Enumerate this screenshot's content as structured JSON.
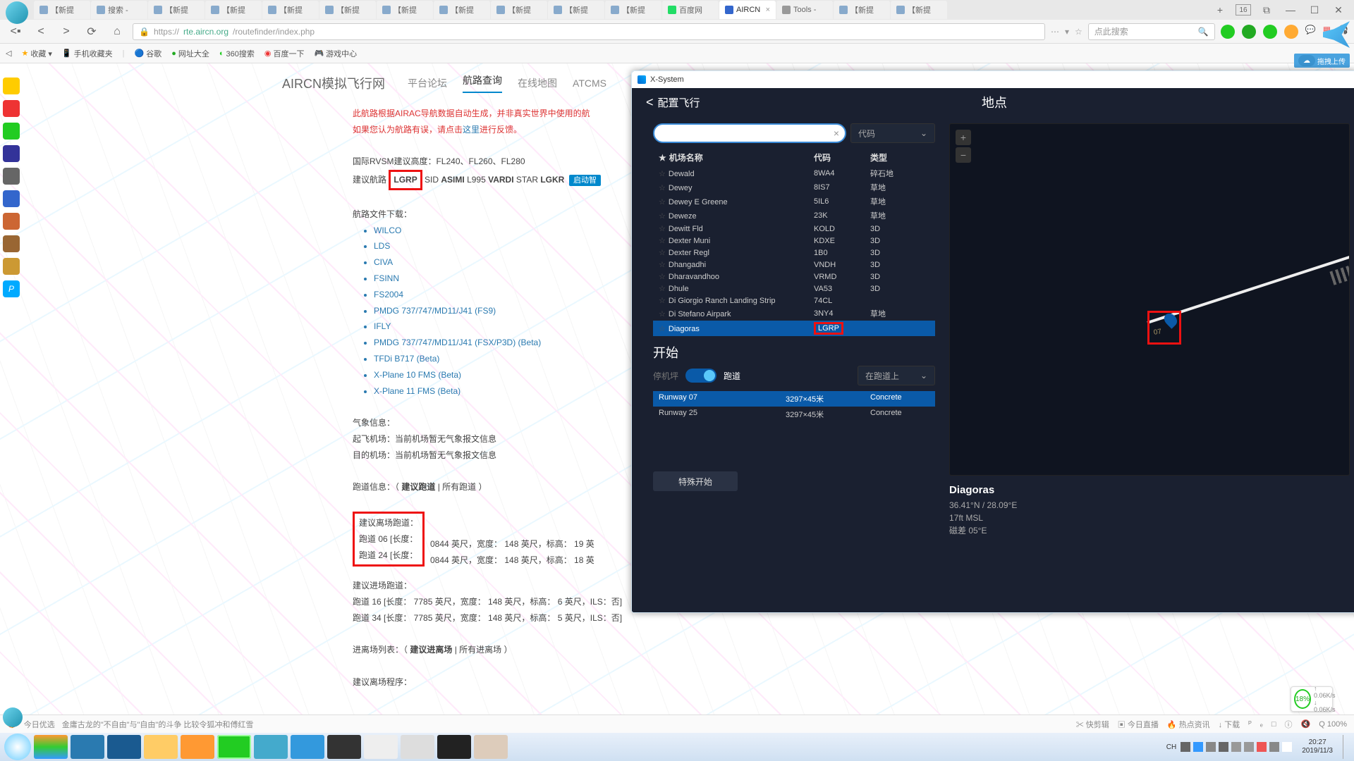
{
  "browser": {
    "tabs": [
      "【新提",
      "搜索 -",
      "【新提",
      "【新提",
      "【新提",
      "【新提",
      "【新提",
      "【新提",
      "【新提",
      "【新提",
      "【新提",
      "百度网",
      "AIRCN",
      "Tools -",
      "【新提",
      "【新提"
    ],
    "active_tab_index": 12,
    "tab_count_badge": "16",
    "url_host": "https://",
    "url_mid": "rte.aircn.org",
    "url_path": "/routefinder/index.php",
    "search_placeholder": "点此搜索",
    "upload_btn": "拖拽上传"
  },
  "bookmarks": [
    "收藏 ▾",
    "手机收藏夹",
    "谷歌",
    "网址大全",
    "360搜索",
    "百度一下",
    "游戏中心"
  ],
  "site": {
    "title": "AIRCN模拟飞行网",
    "nav": [
      "平台论坛",
      "航路查询",
      "在线地图",
      "ATCMS"
    ],
    "active_nav": 1
  },
  "route": {
    "warn1": "此航路根据AIRAC导航数据自动生成，并非真实世界中使用的航",
    "warn2a": "如果您认为航路有误，请点击",
    "warn2link": "这里",
    "warn2b": "进行反馈。",
    "rvsm_label": "国际RVSM建议高度：",
    "rvsm_val": "FL240、FL260、FL280",
    "route_label": "建议航路",
    "route_dep": "LGRP",
    "route_mid1": "SID ",
    "route_mid2": "ASIMI",
    "route_mid3": " L995 ",
    "route_mid4": "VARDI",
    "route_mid5": " STAR ",
    "route_arr": "LGKR",
    "start_btn": "启动智",
    "files_label": "航路文件下载：",
    "files": [
      "WILCO",
      "LDS",
      "CIVA",
      "FSINN",
      "FS2004",
      "PMDG 737/747/MD11/J41 (FS9)",
      "IFLY",
      "PMDG 737/747/MD11/J41 (FSX/P3D) (Beta)",
      "TFDi B717 (Beta)",
      "X-Plane 10 FMS (Beta)",
      "X-Plane 11 FMS (Beta)"
    ],
    "wx_label": "气象信息：",
    "wx_dep": "起飞机场：当前机场暂无气象报文信息",
    "wx_arr": "目的机场：当前机场暂无气象报文信息",
    "rwy_label_a": "跑道信息：（ ",
    "rwy_label_b": "建议跑道",
    "rwy_label_c": " | 所有跑道 ）",
    "dep_rwy_title": "建议离场跑道：",
    "dep_rwy_1": "跑道 06 [长度：",
    "dep_rwy_1b": "0844 英尺，宽度： 148 英尺，标高： 19 英",
    "dep_rwy_2": "跑道 24 [长度：",
    "dep_rwy_2b": "0844 英尺，宽度： 148 英尺，标高： 18 英",
    "arr_rwy_title": "建议进场跑道：",
    "arr_rwy_1": "跑道 16 [长度： 7785 英尺，宽度： 148 英尺，标高： 6 英尺，ILS：否]",
    "arr_rwy_2": "跑道 34 [长度： 7785 英尺，宽度： 148 英尺，标高： 5 英尺，ILS：否]",
    "sidstar_a": "进离场列表：（ ",
    "sidstar_b": "建议进离场",
    "sidstar_c": " | 所有进离场 ）",
    "proc_label": "建议离场程序："
  },
  "xsys": {
    "window_title": "X-System",
    "back_label": "配置飞行",
    "page_title": "地点",
    "search_drop": "代码",
    "head_name": "机场名称",
    "head_code": "代码",
    "head_type": "类型",
    "airports": [
      {
        "name": "Dewald",
        "code": "8WA4",
        "type": "碎石地"
      },
      {
        "name": "Dewey",
        "code": "8IS7",
        "type": "草地"
      },
      {
        "name": "Dewey E Greene",
        "code": "5IL6",
        "type": "草地"
      },
      {
        "name": "Deweze",
        "code": "23K",
        "type": "草地"
      },
      {
        "name": "Dewitt Fld",
        "code": "KOLD",
        "type": "3D"
      },
      {
        "name": "Dexter Muni",
        "code": "KDXE",
        "type": "3D"
      },
      {
        "name": "Dexter Regl",
        "code": "1B0",
        "type": "3D"
      },
      {
        "name": "Dhangadhi",
        "code": "VNDH",
        "type": "3D"
      },
      {
        "name": "Dharavandhoo",
        "code": "VRMD",
        "type": "3D"
      },
      {
        "name": "Dhule",
        "code": "VA53",
        "type": "3D"
      },
      {
        "name": "Di Giorgio Ranch Landing Strip",
        "code": "74CL",
        "type": ""
      },
      {
        "name": "Di Stefano Airpark",
        "code": "3NY4",
        "type": "草地"
      },
      {
        "name": "Diagoras",
        "code": "LGRP",
        "type": ""
      }
    ],
    "selected_airport_index": 12,
    "start_heading": "开始",
    "toggle_off": "停机坪",
    "toggle_on": "跑道",
    "rwy_drop": "在跑道上",
    "runways": [
      {
        "name": "Runway 07",
        "dim": "3297×45米",
        "surf": "Concrete"
      },
      {
        "name": "Runway 25",
        "dim": "3297×45米",
        "surf": "Concrete"
      }
    ],
    "selected_runway_index": 0,
    "special_btn": "特殊开始",
    "pin_label": "07",
    "loc_name": "Diagoras",
    "loc_coords": "36.41°N / 28.09°E",
    "loc_elev": "17ft MSL",
    "loc_magvar": "磁差 05°E"
  },
  "netbadge": {
    "pct": "18%",
    "up": "0.06K/s",
    "down": "0.06K/s"
  },
  "status": {
    "left1": "今日优选",
    "left2": "金庸古龙的\"不自由\"与\"自由\"的斗争 比较令狐冲和傅红雪",
    "items": [
      "快剪辑",
      "今日直播",
      "热点资讯",
      "↓ 下载",
      "ᴾ",
      "ₑ",
      "□",
      "ⓘ",
      "Q 100%"
    ]
  },
  "taskbar": {
    "lang": "CH",
    "time": "20:27",
    "date": "2019/11/3"
  }
}
